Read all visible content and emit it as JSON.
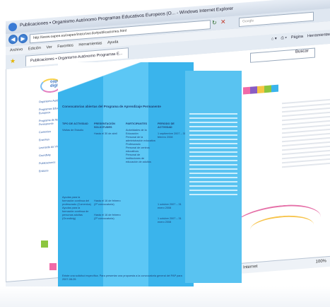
{
  "window": {
    "title": "Publicaciones • Organismo Autónomo Programas Educativos Europeos (O... - Windows Internet Explorer",
    "address": "http://www.oapee.es/oapee/inicio/ver.do#publicaciones.html",
    "search_placeholder": "Google",
    "tab_label": "Publicaciones • Organismo Autónomo Programas E...",
    "buttons": {
      "minimize": "_",
      "maximize": "□",
      "close": "x"
    }
  },
  "menu": [
    "Archivo",
    "Edición",
    "Ver",
    "Favoritos",
    "Herramientas",
    "Ayuda"
  ],
  "command_bar": {
    "page": "Página",
    "tools": "Herramientas"
  },
  "page_search": {
    "button": "Buscar"
  },
  "left_page": {
    "logo": "oapee digital",
    "nav": [
      "Organismo Autónomo",
      "Programas Educativos Europeos",
      "Programa de Aprendizaje Permanente",
      "Comenius",
      "Erasmus",
      "Leonardo da Vinci",
      "Grundtvig",
      "Publicaciones",
      "Enlaces"
    ]
  },
  "document": {
    "heading": "Convocatorias abiertas del Programa de Aprendizaje Permanente",
    "columns": [
      {
        "header": "TIPO DE ACTIVIDAD",
        "lines": [
          "Visitas de Estudio",
          "Ayudas para la formación continua del profesorado (Comenius)",
          "Ayudas para la formación continua de personas adultas (Grundtvig)"
        ]
      },
      {
        "header": "PRESENTACIÓN SOLICITUDES",
        "lines": [
          "Hasta el 30 de abril",
          "Hasta el 16 de febrero (2ª convocatoria)",
          "Hasta el 16 de febrero (2ª convocatoria)"
        ]
      },
      {
        "header": "PARTICIPANTES",
        "lines": [
          "Autoridades de la Educación",
          "Personal de la administración educativa",
          "Profesorado",
          "Personal de centros educativos",
          "Personal de instituciones de educación de adultos"
        ]
      },
      {
        "header": "PERIODO DE ACTIVIDAD",
        "lines": [
          "1 septiembre 2007 – 30 febrero 2008",
          "1 octubre 2007 – 31 enero 2008",
          "1 octubre 2007 – 31 enero 2008"
        ]
      }
    ],
    "footer": "Existe una solicitud específica. Para presentar una propuesta a la convocatoria general del PAP para 2007-08-09."
  },
  "status_bar": {
    "zone": "Internet",
    "zoom": "100%"
  }
}
